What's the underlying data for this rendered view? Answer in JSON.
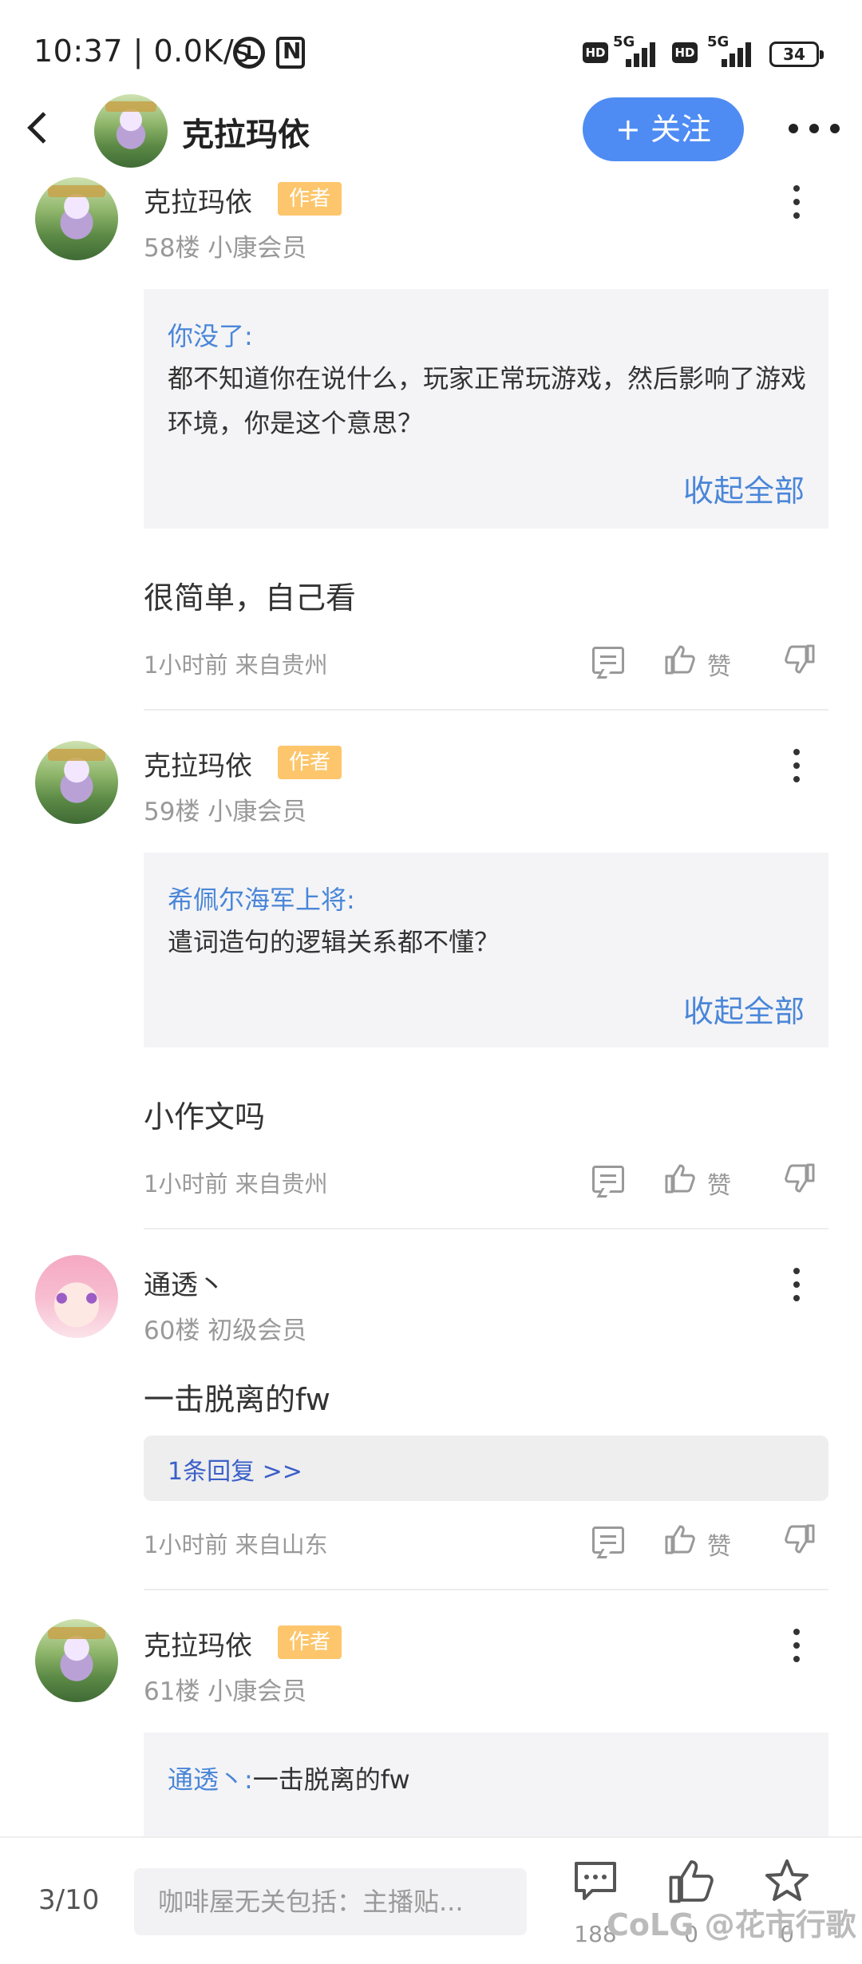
{
  "status_bar": {
    "time": "10:37 | 0.0K/s",
    "net1_hd": "HD",
    "net1_type": "5G",
    "net2_hd": "HD",
    "net2_type": "5G",
    "battery": "34"
  },
  "header": {
    "title": "克拉玛依",
    "follow_label": "+ 关注"
  },
  "posts": [
    {
      "user": "克拉玛依",
      "tag": "作者",
      "meta": "58楼 小康会员",
      "quote_name": "你没了:",
      "quote_text": "都不知道你在说什么，玩家正常玩游戏，然后影响了游戏环境，你是这个意思？",
      "collapse_label": "收起全部",
      "content": "很简单，自己看",
      "time": "1小时前 来自贵州",
      "like_label": "赞"
    },
    {
      "user": "克拉玛依",
      "tag": "作者",
      "meta": "59楼 小康会员",
      "quote_name": "希佩尔海军上将:",
      "quote_text": "遣词造句的逻辑关系都不懂？",
      "collapse_label": "收起全部",
      "content": "小作文吗",
      "time": "1小时前 来自贵州",
      "like_label": "赞"
    },
    {
      "user": "通透丶",
      "meta": "60楼 初级会员",
      "content": "一击脱离的fw",
      "reply_count": "1条回复 >>",
      "time": "1小时前 来自山东",
      "like_label": "赞"
    },
    {
      "user": "克拉玛依",
      "tag": "作者",
      "meta": "61楼 小康会员",
      "quote_name": "通透丶:",
      "quote_text": "一击脱离的fw"
    }
  ],
  "bottom_bar": {
    "page": "3/10",
    "input_placeholder": "咖啡屋无关包括：主播贴...",
    "comment_count": "188",
    "like_count": "0",
    "favorite_count": "0"
  },
  "watermark": "CoLG @花市行歌",
  "colors": {
    "accent_blue": "#4e8cf4",
    "author_tag": "#fdc66c",
    "quote_link": "#4a86d8"
  }
}
